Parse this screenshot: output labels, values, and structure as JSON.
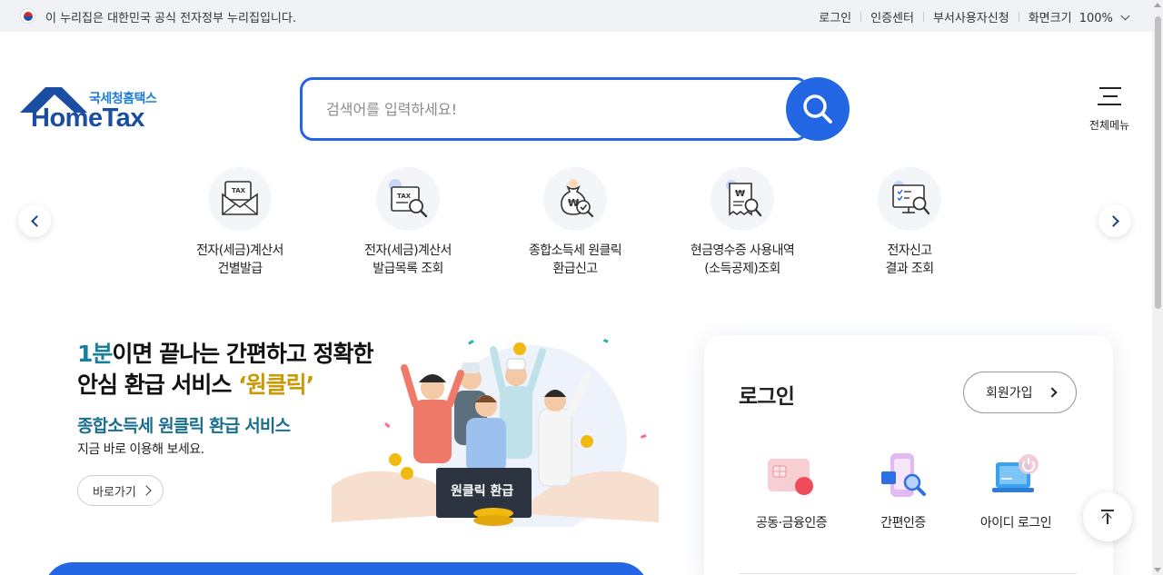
{
  "govbar": {
    "notice": "이 누리집은 대한민국 공식 전자정부 누리집입니다.",
    "links": [
      "로그인",
      "인증센터",
      "부서사용자신청"
    ],
    "zoom_label": "화면크기",
    "zoom_value": "100%"
  },
  "logo": {
    "sub": "국세청홈택스",
    "main": "HomeTax"
  },
  "search": {
    "placeholder": "검색어를 입력하세요!",
    "value": ""
  },
  "fullmenu": {
    "label": "전체메뉴"
  },
  "quick_menu": [
    {
      "label": "전자(세금)계산서\n건별발급",
      "icon": "tax-envelope-icon"
    },
    {
      "label": "전자(세금)계산서\n발급목록 조회",
      "icon": "tax-search-icon"
    },
    {
      "label": "종합소득세 원클릭\n환급신고",
      "icon": "money-bag-icon"
    },
    {
      "label": "현금영수증 사용내역\n(소득공제)조회",
      "icon": "receipt-search-icon"
    },
    {
      "label": "전자신고\n결과 조회",
      "icon": "monitor-search-icon"
    }
  ],
  "banner": {
    "line1_accent": "1분",
    "line1_rest": "이면 끝나는 간편하고 정확한",
    "line2_rest": "안심 환급 서비스 ",
    "line2_accent": "‘원클릭’",
    "line3": "종합소득세 원클릭 환급 서비스",
    "line4": "지금 바로 이용해 보세요.",
    "go_label": "바로가기",
    "illus_sign": "원클릭 환급"
  },
  "login": {
    "title": "로그인",
    "join_label": "회원가입",
    "options": [
      {
        "label": "공동·금융인증",
        "icon": "certificate-icon"
      },
      {
        "label": "간편인증",
        "icon": "phone-auth-icon"
      },
      {
        "label": "아이디 로그인",
        "icon": "laptop-power-icon"
      }
    ]
  },
  "colors": {
    "primary": "#2366e4",
    "logo_blue": "#1a4ea2",
    "teal_accent": "#1a7f9a"
  }
}
